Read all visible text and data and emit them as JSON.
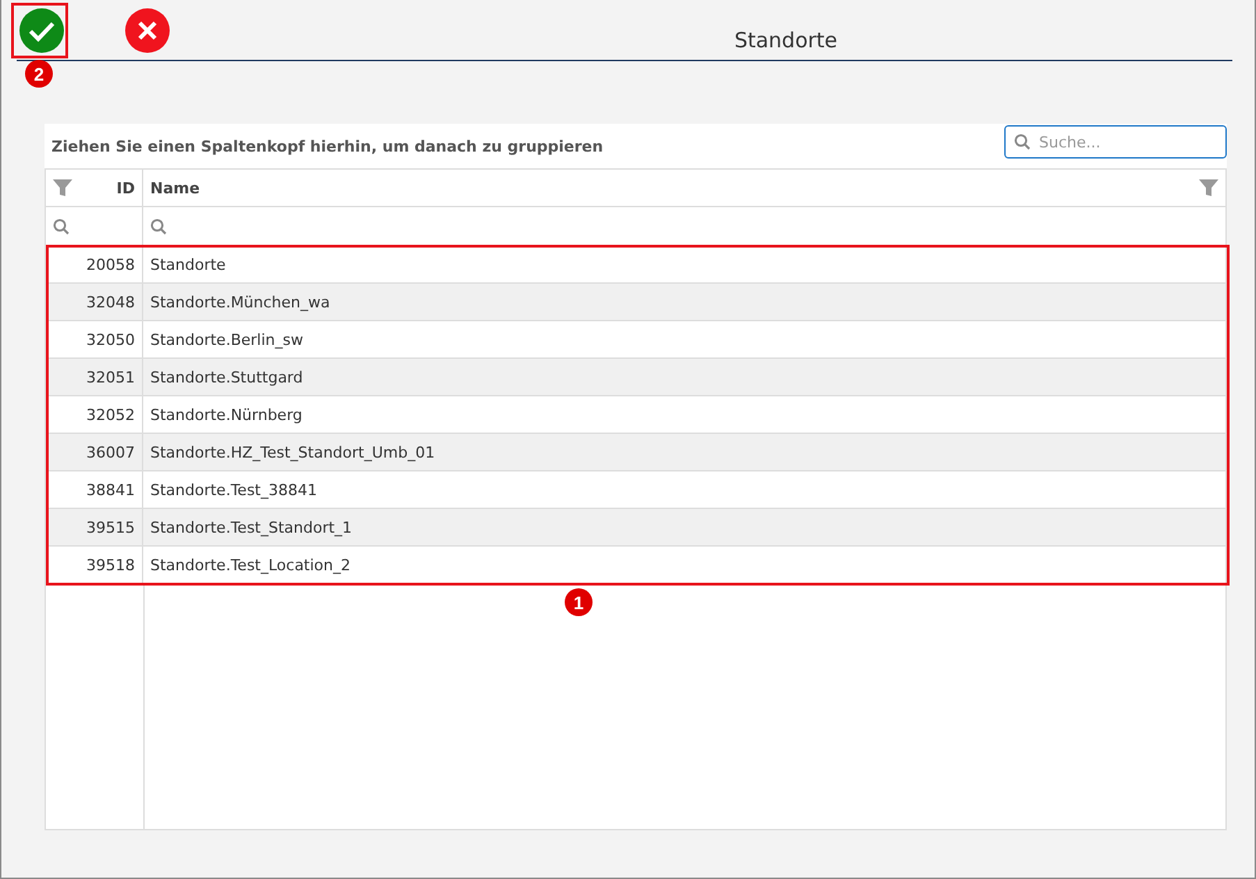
{
  "window": {
    "title": "Standorte"
  },
  "toolbar": {
    "buttons": [
      {
        "kind": "confirm"
      },
      {
        "kind": "cancel"
      }
    ]
  },
  "grid": {
    "group_hint": "Ziehen Sie einen Spaltenkopf hierhin, um danach zu gruppieren",
    "search": {
      "placeholder": "Suche..."
    },
    "columns": [
      "ID",
      "Name"
    ],
    "rows": [
      {
        "id": "20058",
        "name": "Standorte"
      },
      {
        "id": "32048",
        "name": "Standorte.München_wa"
      },
      {
        "id": "32050",
        "name": "Standorte.Berlin_sw"
      },
      {
        "id": "32051",
        "name": "Standorte.Stuttgard"
      },
      {
        "id": "32052",
        "name": "Standorte.Nürnberg"
      },
      {
        "id": "36007",
        "name": "Standorte.HZ_Test_Standort_Umb_01"
      },
      {
        "id": "38841",
        "name": "Standorte.Test_38841"
      },
      {
        "id": "39515",
        "name": "Standorte.Test_Standort_1"
      },
      {
        "id": "39518",
        "name": "Standorte.Test_Location_2"
      }
    ]
  },
  "annotations": [
    {
      "label": "1",
      "kind": "rows"
    },
    {
      "label": "2",
      "kind": "confirm"
    }
  ]
}
